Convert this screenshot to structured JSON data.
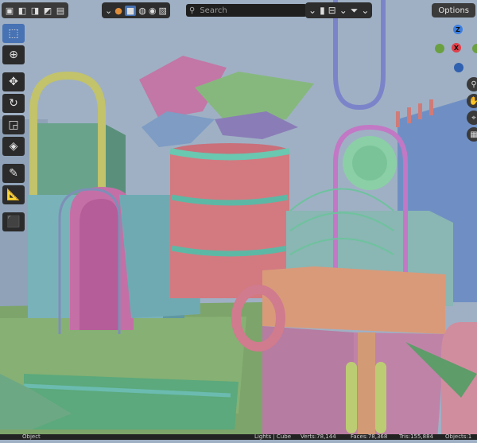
{
  "header": {
    "search": {
      "placeholder": "Search"
    },
    "options_label": "Options"
  },
  "gizmo": {
    "z_label": "Z",
    "x_label": "X"
  },
  "statusbar": {
    "mode": "Object",
    "collection": "Lights | Cube",
    "verts": "Verts:78,144",
    "faces": "Faces:78,368",
    "tris": "Tris:155,884",
    "objects": "Objects:1"
  },
  "colors": {
    "viewport_bg": "#9fb0c4",
    "accent": "#4772b3",
    "toolbar_bg": "#2b2b2b"
  },
  "toolbar_icons": [
    "select-box-icon",
    "cursor-icon",
    "move-icon",
    "rotate-icon",
    "scale-icon",
    "transform-icon",
    "annotate-icon",
    "measure-icon",
    "add-cube-icon"
  ]
}
